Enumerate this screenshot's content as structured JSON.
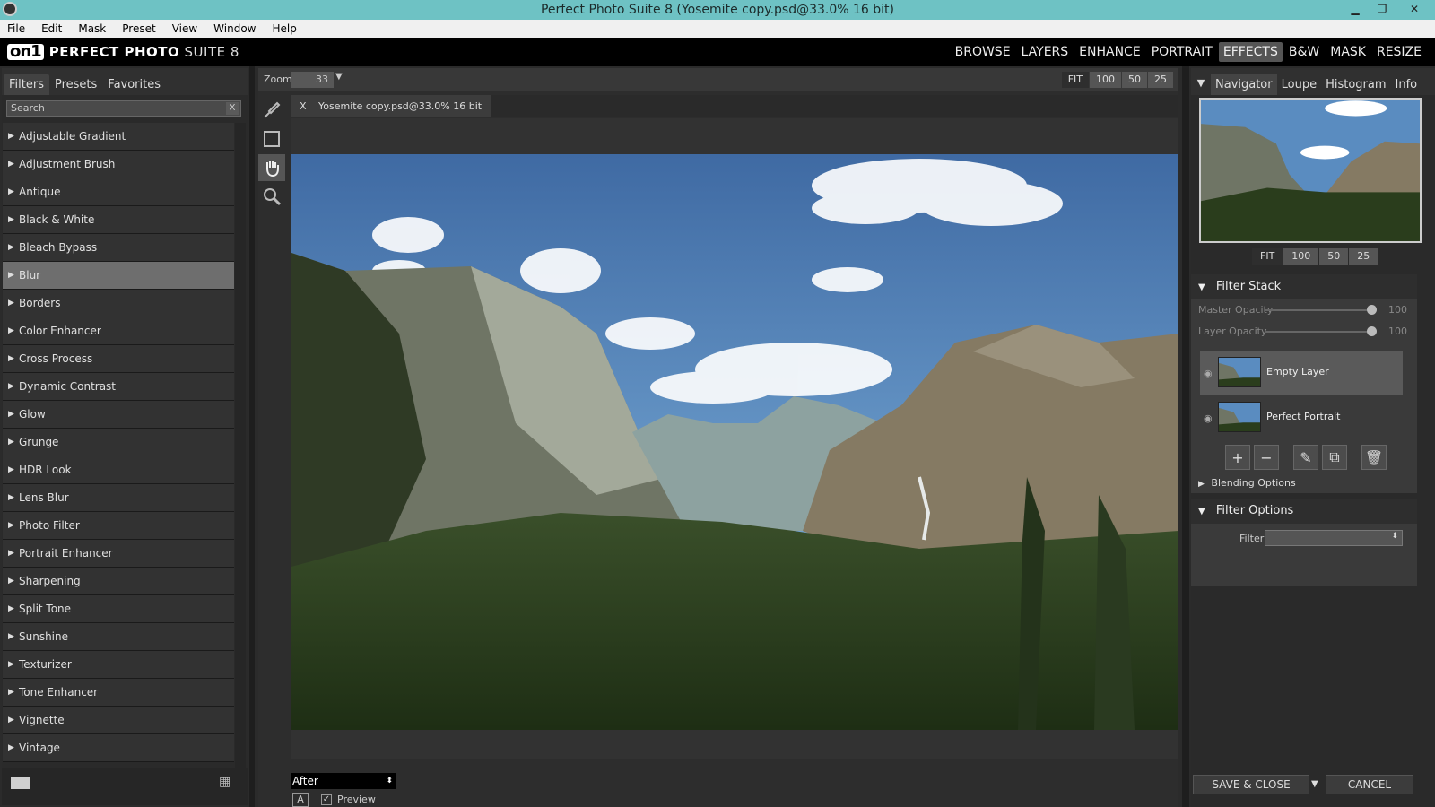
{
  "window": {
    "title": "Perfect Photo Suite 8 (Yosemite copy.psd@33.0% 16 bit)"
  },
  "menu": [
    "File",
    "Edit",
    "Mask",
    "Preset",
    "View",
    "Window",
    "Help"
  ],
  "brand": {
    "logo": "on1",
    "name_bold": "PERFECT PHOTO",
    "name_rest": " SUITE 8"
  },
  "modules": [
    {
      "label": "BROWSE",
      "active": false
    },
    {
      "label": "LAYERS",
      "active": false
    },
    {
      "label": "ENHANCE",
      "active": false
    },
    {
      "label": "PORTRAIT",
      "active": false
    },
    {
      "label": "EFFECTS",
      "active": true
    },
    {
      "label": "B&W",
      "active": false
    },
    {
      "label": "MASK",
      "active": false
    },
    {
      "label": "RESIZE",
      "active": false
    }
  ],
  "left_panel": {
    "tabs": [
      {
        "label": "Filters",
        "active": true
      },
      {
        "label": "Presets",
        "active": false
      },
      {
        "label": "Favorites",
        "active": false
      }
    ],
    "search_placeholder": "Search",
    "search_clear": "X",
    "filters": [
      {
        "label": "Adjustable Gradient",
        "selected": false
      },
      {
        "label": "Adjustment Brush",
        "selected": false
      },
      {
        "label": "Antique",
        "selected": false
      },
      {
        "label": "Black & White",
        "selected": false
      },
      {
        "label": "Bleach Bypass",
        "selected": false
      },
      {
        "label": "Blur",
        "selected": true
      },
      {
        "label": "Borders",
        "selected": false
      },
      {
        "label": "Color Enhancer",
        "selected": false
      },
      {
        "label": "Cross Process",
        "selected": false
      },
      {
        "label": "Dynamic Contrast",
        "selected": false
      },
      {
        "label": "Glow",
        "selected": false
      },
      {
        "label": "Grunge",
        "selected": false
      },
      {
        "label": "HDR Look",
        "selected": false
      },
      {
        "label": "Lens Blur",
        "selected": false
      },
      {
        "label": "Photo Filter",
        "selected": false
      },
      {
        "label": "Portrait Enhancer",
        "selected": false
      },
      {
        "label": "Sharpening",
        "selected": false
      },
      {
        "label": "Split Tone",
        "selected": false
      },
      {
        "label": "Sunshine",
        "selected": false
      },
      {
        "label": "Texturizer",
        "selected": false
      },
      {
        "label": "Tone Enhancer",
        "selected": false
      },
      {
        "label": "Vignette",
        "selected": false
      },
      {
        "label": "Vintage",
        "selected": false
      }
    ]
  },
  "center": {
    "zoom_label": "Zoom",
    "zoom_value": "33",
    "zoom_buttons": [
      {
        "label": "FIT",
        "on": true
      },
      {
        "label": "100",
        "on": false
      },
      {
        "label": "50",
        "on": false
      },
      {
        "label": "25",
        "on": false
      }
    ],
    "doc_tab_close": "X",
    "doc_tab_label": "Yosemite copy.psd@33.0% 16 bit",
    "view_mode": "After",
    "a_button": "A",
    "preview_label": "Preview",
    "preview_checked": true
  },
  "right_panel": {
    "nav_tabs": [
      {
        "label": "Navigator",
        "active": true
      },
      {
        "label": "Loupe",
        "active": false
      },
      {
        "label": "Histogram",
        "active": false
      },
      {
        "label": "Info",
        "active": false
      }
    ],
    "nav_zoom_buttons": [
      {
        "label": "FIT",
        "on": true
      },
      {
        "label": "100",
        "on": false
      },
      {
        "label": "50",
        "on": false
      },
      {
        "label": "25",
        "on": false
      }
    ],
    "filter_stack": {
      "title": "Filter Stack",
      "master_opacity_label": "Master Opacity",
      "master_opacity_value": "100",
      "layer_opacity_label": "Layer Opacity",
      "layer_opacity_value": "100",
      "layers": [
        {
          "name": "Empty Layer",
          "selected": true
        },
        {
          "name": "Perfect Portrait",
          "selected": false
        }
      ],
      "blending_label": "Blending Options"
    },
    "filter_options": {
      "title": "Filter Options",
      "filter_label": "Filter",
      "filter_value": ""
    },
    "save_label": "SAVE & CLOSE",
    "cancel_label": "CANCEL"
  }
}
